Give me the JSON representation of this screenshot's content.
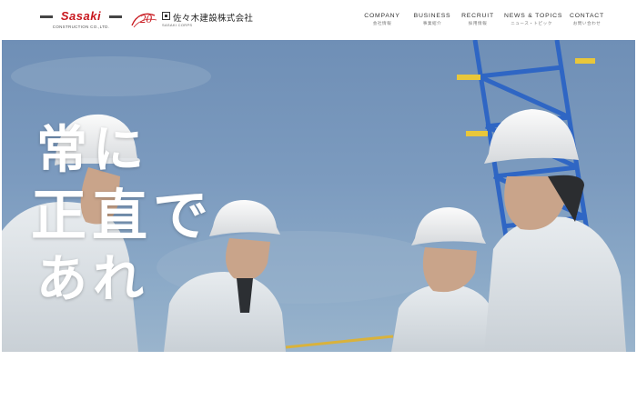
{
  "header": {
    "logo": {
      "wordmark": "Sasaki",
      "tagline": "CONSTRUCTION CO.,LTD."
    },
    "anniversary_mark": "20",
    "company": {
      "name": "佐々木建設株式会社",
      "subname": "SASAKI CORPS"
    }
  },
  "nav": [
    {
      "en": "COMPANY",
      "jp": "会社情報"
    },
    {
      "en": "BUSINESS",
      "jp": "事業紹介"
    },
    {
      "en": "RECRUIT",
      "jp": "採用情報"
    },
    {
      "en": "NEWS & TOPICS",
      "jp": "ニュース・トピック"
    },
    {
      "en": "CONTACT",
      "jp": "お問い合わせ"
    }
  ],
  "hero": {
    "slogan": {
      "line1": "常に",
      "line2": "正直で",
      "line3": "あれ"
    }
  },
  "colors": {
    "brand_red": "#c8171e",
    "sky": "#7c9bbf",
    "crane_blue": "#2f66c4",
    "white": "#ffffff"
  }
}
